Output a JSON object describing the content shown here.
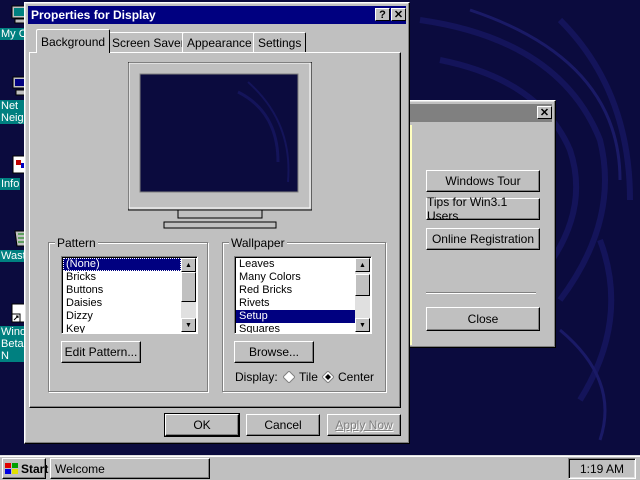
{
  "desktop": {
    "icons": [
      {
        "label": "My Co",
        "name": "my-computer"
      },
      {
        "label": "Net\nNeigh",
        "name": "network-neighborhood"
      },
      {
        "label": "Info",
        "name": "inbox"
      },
      {
        "label": "Waste",
        "name": "recycle-bin"
      },
      {
        "label": "Wind\nBeta R\nN",
        "name": "windows-beta-shortcut"
      }
    ]
  },
  "welcome": {
    "close_symbol": "✕",
    "buttons": {
      "tour": "Windows Tour",
      "tips": "Tips for Win3.1 Users",
      "registration": "Online Registration",
      "close": "Close"
    }
  },
  "dialog": {
    "title": "Properties for Display",
    "help_symbol": "?",
    "close_symbol": "✕",
    "tabs": [
      "Background",
      "Screen Saver",
      "Appearance",
      "Settings"
    ],
    "active_tab": 0,
    "pattern": {
      "label": "Pattern",
      "items": [
        "(None)",
        "Bricks",
        "Buttons",
        "Daisies",
        "Dizzy",
        "Key"
      ],
      "selected": 0,
      "edit_button": "Edit Pattern..."
    },
    "wallpaper": {
      "label": "Wallpaper",
      "items": [
        "Leaves",
        "Many Colors",
        "Red Bricks",
        "Rivets",
        "Setup",
        "Squares"
      ],
      "selected": 4,
      "browse_button": "Browse...",
      "display_label": "Display:",
      "display_options": [
        "Tile",
        "Center"
      ],
      "display_selected": "Center"
    },
    "buttons": {
      "ok": "OK",
      "cancel": "Cancel",
      "apply": "Apply Now"
    }
  },
  "taskbar": {
    "start_label": "Start",
    "task_label": "Welcome",
    "clock": "1:19 AM"
  },
  "colors": {
    "desktop": "#0b0b3e",
    "titlebar": "#000080",
    "face": "#c0c0c0",
    "icon_label_bg": "#008080"
  }
}
